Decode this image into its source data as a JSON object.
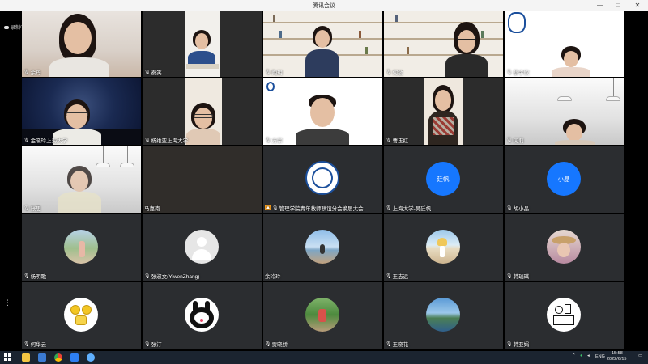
{
  "window": {
    "title": "腾讯会议",
    "min_glyph": "—",
    "max_glyph": "□",
    "close_glyph": "✕"
  },
  "recording": {
    "label": "录制中"
  },
  "side_menu_glyph": "⋮",
  "mic_glyph": "🎙",
  "participants": [
    {
      "name": "余丹",
      "kind": "video"
    },
    {
      "name": "秦笑",
      "kind": "video"
    },
    {
      "name": "陶玥",
      "kind": "video"
    },
    {
      "name": "何敏",
      "kind": "video"
    },
    {
      "name": "蔡宇欣",
      "kind": "video"
    },
    {
      "name": "金晓玲上海大学",
      "kind": "video"
    },
    {
      "name": "杨维亚上海大学",
      "kind": "video"
    },
    {
      "name": "方宗",
      "kind": "video"
    },
    {
      "name": "曹玉红",
      "kind": "video"
    },
    {
      "name": "何莉",
      "kind": "video"
    },
    {
      "name": "张思",
      "kind": "video"
    },
    {
      "name": "马嘉南",
      "kind": "empty"
    },
    {
      "name": "管理学院青年教师联谊分会换届大会",
      "kind": "logo",
      "host": true
    },
    {
      "name": "上海大学-吴廷帆",
      "kind": "text-avatar",
      "avatar_text": "廷帆"
    },
    {
      "name": "胡小晶",
      "kind": "text-avatar",
      "avatar_text": "小晶"
    },
    {
      "name": "杨明歌",
      "kind": "photo-avatar",
      "avatar_icon": "outdoor-photo"
    },
    {
      "name": "张淑文(YiwenZhang)",
      "kind": "photo-avatar",
      "avatar_icon": "default-user"
    },
    {
      "name": "余玲玲",
      "kind": "photo-avatar",
      "avatar_icon": "seaside-photo"
    },
    {
      "name": "王志远",
      "kind": "photo-avatar",
      "avatar_icon": "beach-photo"
    },
    {
      "name": "韩瑞琪",
      "kind": "photo-avatar",
      "avatar_icon": "hat-photo"
    },
    {
      "name": "何华云",
      "kind": "photo-avatar",
      "avatar_icon": "cartoon-coins"
    },
    {
      "name": "张汀",
      "kind": "photo-avatar",
      "avatar_icon": "cartoon-rabbit"
    },
    {
      "name": "贾晓娇",
      "kind": "photo-avatar",
      "avatar_icon": "garden-photo"
    },
    {
      "name": "王晓花",
      "kind": "photo-avatar",
      "avatar_icon": "coast-photo"
    },
    {
      "name": "韩亚娟",
      "kind": "photo-avatar",
      "avatar_icon": "sketch-drawing"
    }
  ],
  "taskbar": {
    "language": "ENG",
    "time": "15:58",
    "date": "2022/6/15"
  },
  "colors": {
    "tile_bg": "#2b2d30",
    "text_avatar_bg": "#1677ff",
    "taskbar_bg": "#1b2430",
    "logo_blue": "#1b4f9c"
  }
}
